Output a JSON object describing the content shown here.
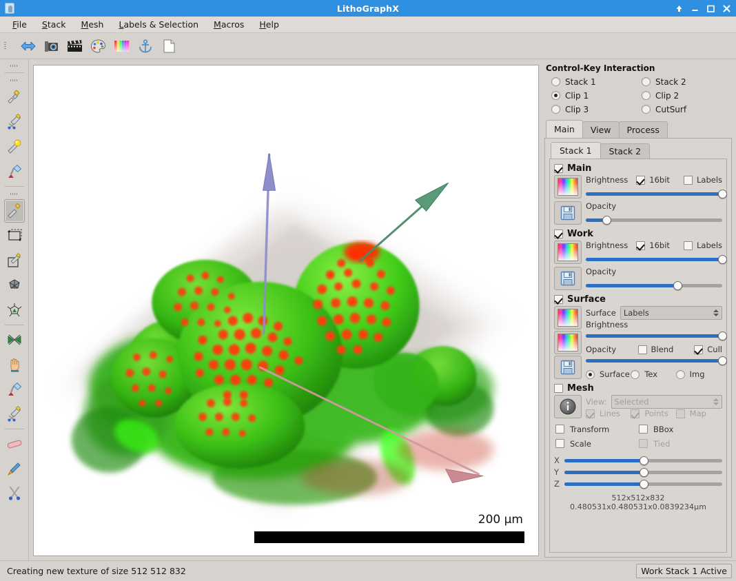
{
  "window": {
    "title": "LithoGraphX",
    "app_icon": "microscope-icon",
    "buttons": [
      {
        "name": "shade-button",
        "icon": "up-arrow-icon"
      },
      {
        "name": "minimize-button",
        "icon": "minimize-icon"
      },
      {
        "name": "maximize-button",
        "icon": "maximize-icon"
      },
      {
        "name": "close-button",
        "icon": "close-icon"
      }
    ]
  },
  "menubar": {
    "items": [
      {
        "label": "File",
        "mnemonic": "F"
      },
      {
        "label": "Stack",
        "mnemonic": "S"
      },
      {
        "label": "Mesh",
        "mnemonic": "M"
      },
      {
        "label": "Labels & Selection",
        "mnemonic": "L"
      },
      {
        "label": "Macros",
        "mnemonic": "M"
      },
      {
        "label": "Help",
        "mnemonic": "H"
      }
    ]
  },
  "toolbar_top": {
    "items": [
      {
        "name": "reset-view-button",
        "icon": "blue-double-arrow-icon"
      },
      {
        "name": "snapshot-button",
        "icon": "camera-icon"
      },
      {
        "name": "movie-button",
        "icon": "clapperboard-icon"
      },
      {
        "name": "palette-button",
        "icon": "palette-icon"
      },
      {
        "name": "colorbars-button",
        "icon": "color-bars-icon"
      },
      {
        "name": "anchor-button",
        "icon": "anchor-icon"
      },
      {
        "name": "new-document-button",
        "icon": "document-icon"
      }
    ]
  },
  "toolbar_left": {
    "items": [
      {
        "name": "pick-tool",
        "icon": "pipette-icon",
        "active": false
      },
      {
        "name": "pick-cut-tool",
        "icon": "pipette-scissors-icon",
        "active": false
      },
      {
        "name": "highlight-tool",
        "icon": "magic-wand-icon",
        "active": false
      },
      {
        "name": "fill-tool",
        "icon": "paint-bucket-lamp-icon",
        "active": false
      },
      {
        "name": "pick-voxel-tool",
        "icon": "pipette-icon",
        "active": true
      },
      {
        "name": "bounding-box-tool",
        "icon": "bbox-icon",
        "active": false
      },
      {
        "name": "bbox-pick-tool",
        "icon": "bbox-pipette-icon",
        "active": false
      },
      {
        "name": "mesh-tool",
        "icon": "polyhedron-icon",
        "active": false
      },
      {
        "name": "vertex-tool",
        "icon": "vertex-star-icon",
        "active": false
      },
      {
        "name": "mirror-tool",
        "icon": "mirror-arrows-icon",
        "active": false
      },
      {
        "name": "pan-tool",
        "icon": "hand-icon",
        "active": false
      },
      {
        "name": "fill-label-tool",
        "icon": "paint-bucket-lamp-icon",
        "active": false
      },
      {
        "name": "cut-pipette-tool",
        "icon": "pipette-scissors-icon",
        "active": false
      },
      {
        "name": "eraser-tool",
        "icon": "eraser-icon",
        "active": false
      },
      {
        "name": "brush-tool",
        "icon": "paintbrush-icon",
        "active": false
      },
      {
        "name": "scissors-tool",
        "icon": "scissors-icon",
        "active": false
      }
    ]
  },
  "viewport": {
    "scalebar_label": "200 µm",
    "scene_description": "3D volumetric fluorescence rendering of plant meristem with green cell walls and red nuclei",
    "axes": [
      {
        "name": "z-axis-arrow",
        "color": "#8e8ecb"
      },
      {
        "name": "y-axis-arrow",
        "color": "#4b8a6a"
      },
      {
        "name": "x-axis-arrow",
        "color": "#cf9aa0"
      }
    ]
  },
  "control_key_interaction": {
    "title": "Control-Key Interaction",
    "options": [
      {
        "label": "Stack 1",
        "selected": false
      },
      {
        "label": "Stack 2",
        "selected": false
      },
      {
        "label": "Clip 1",
        "selected": true
      },
      {
        "label": "Clip 2",
        "selected": false
      },
      {
        "label": "Clip 3",
        "selected": false
      },
      {
        "label": "CutSurf",
        "selected": false
      }
    ]
  },
  "main_tabs": [
    {
      "label": "Main",
      "selected": true
    },
    {
      "label": "View",
      "selected": false
    },
    {
      "label": "Process",
      "selected": false
    }
  ],
  "stack_tabs": [
    {
      "label": "Stack 1",
      "selected": true
    },
    {
      "label": "Stack 2",
      "selected": false
    }
  ],
  "sections": {
    "main": {
      "title": "Main",
      "enabled": true,
      "gradient_button": "color-gradient-icon",
      "save_button": "save-floppy-icon",
      "brightness_label": "Brightness",
      "brightness_value": 100,
      "opacity_label": "Opacity",
      "opacity_value": 15,
      "bit_label": "16bit",
      "bit_checked": true,
      "labels_label": "Labels",
      "labels_checked": false
    },
    "work": {
      "title": "Work",
      "enabled": true,
      "gradient_button": "color-gradient-icon",
      "save_button": "save-floppy-icon",
      "brightness_label": "Brightness",
      "brightness_value": 100,
      "opacity_label": "Opacity",
      "opacity_value": 67,
      "bit_label": "16bit",
      "bit_checked": true,
      "labels_label": "Labels",
      "labels_checked": false
    },
    "surface": {
      "title": "Surface",
      "enabled": true,
      "surface_label": "Surface",
      "surface_value": "Labels",
      "brightness_label": "Brightness",
      "brightness_value": 100,
      "opacity_label": "Opacity",
      "opacity_value": 100,
      "blend_label": "Blend",
      "blend_checked": false,
      "cull_label": "Cull",
      "cull_checked": true,
      "render_modes": [
        {
          "label": "Surface",
          "selected": true
        },
        {
          "label": "Tex",
          "selected": false
        },
        {
          "label": "Img",
          "selected": false
        }
      ]
    },
    "mesh": {
      "title": "Mesh",
      "enabled": false,
      "info_button": "info-icon",
      "view_label": "View:",
      "view_value": "Selected",
      "lines_label": "Lines",
      "lines_checked": true,
      "points_label": "Points",
      "points_checked": true,
      "map_label": "Map",
      "map_checked": false,
      "transform_label": "Transform",
      "transform_checked": false,
      "bbox_label": "BBox",
      "bbox_checked": false,
      "scale_label": "Scale",
      "scale_checked": false,
      "tied_label": "Tied",
      "tied_checked": false
    },
    "clip_sliders": {
      "x_label": "X",
      "x_value": 50,
      "y_label": "Y",
      "y_value": 50,
      "z_label": "Z",
      "z_value": 50
    },
    "dimensions": "512x512x832   0.480531x0.480531x0.0839234µm"
  },
  "statusbar": {
    "message": "Creating new texture of size 512 512 832",
    "active_chip": "Work Stack 1 Active"
  },
  "colors": {
    "titlebar": "#2f8fe0",
    "chrome": "#d6d2cd",
    "slider_fill": "#2a6fc4",
    "panel": "#d9d5d0"
  }
}
